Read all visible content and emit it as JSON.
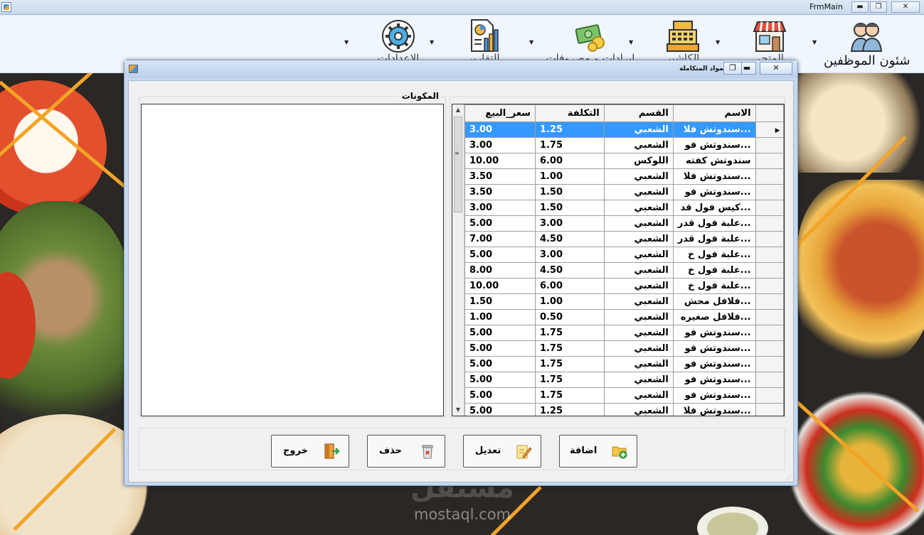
{
  "window": {
    "title": "FrmMain",
    "controls": {
      "minimize": "▬",
      "maximize": "❐",
      "close": "✕"
    }
  },
  "menu": {
    "items": [
      {
        "label": "شئون الموظفين",
        "icon": "employees-icon"
      },
      {
        "label": "المتجر",
        "icon": "store-icon"
      },
      {
        "label": "الكاشير",
        "icon": "cash-register-icon"
      },
      {
        "label": "ايرادات و مصروفات",
        "icon": "money-icon"
      },
      {
        "label": "التقارير",
        "icon": "report-icon"
      },
      {
        "label": "الاعدادات",
        "icon": "settings-icon"
      }
    ]
  },
  "watermark": {
    "logo": "مستقل",
    "text": "mostaql.com"
  },
  "dialog": {
    "title": "المواد المتكاملة",
    "ingredients_label": "المكونات",
    "grid": {
      "columns": [
        "الاسم",
        "القسم",
        "التكلفة",
        "سعر_البيع"
      ],
      "rows": [
        {
          "name": "سندوتش فلا...",
          "category": "الشعبي",
          "cost": "1.25",
          "price": "3.00"
        },
        {
          "name": "سندوتش فو...",
          "category": "الشعبي",
          "cost": "1.75",
          "price": "3.00"
        },
        {
          "name": "سندوتش كفته",
          "category": "اللوكس",
          "cost": "6.00",
          "price": "10.00"
        },
        {
          "name": "سندوتش فلا...",
          "category": "الشعبي",
          "cost": "1.00",
          "price": "3.50"
        },
        {
          "name": "سندوتش فو...",
          "category": "الشعبي",
          "cost": "1.50",
          "price": "3.50"
        },
        {
          "name": "كيس فول قد...",
          "category": "الشعبي",
          "cost": "1.50",
          "price": "3.00"
        },
        {
          "name": "علبة فول قدر...",
          "category": "الشعبي",
          "cost": "3.00",
          "price": "5.00"
        },
        {
          "name": "علبة فول قدر...",
          "category": "الشعبي",
          "cost": "4.50",
          "price": "7.00"
        },
        {
          "name": "علبة فول خ...",
          "category": "الشعبي",
          "cost": "3.00",
          "price": "5.00"
        },
        {
          "name": "علبة فول خ...",
          "category": "الشعبي",
          "cost": "4.50",
          "price": "8.00"
        },
        {
          "name": "علبة فول خ...",
          "category": "الشعبي",
          "cost": "6.00",
          "price": "10.00"
        },
        {
          "name": "فلافل محش...",
          "category": "الشعبي",
          "cost": "1.00",
          "price": "1.50"
        },
        {
          "name": "فلافل صغيره...",
          "category": "الشعبي",
          "cost": "0.50",
          "price": "1.00"
        },
        {
          "name": "سندوتش فو...",
          "category": "الشعبي",
          "cost": "1.75",
          "price": "5.00"
        },
        {
          "name": "سندوتش فو...",
          "category": "الشعبي",
          "cost": "1.75",
          "price": "5.00"
        },
        {
          "name": "سندوتش فو...",
          "category": "الشعبي",
          "cost": "1.75",
          "price": "5.00"
        },
        {
          "name": "سندوتش فو...",
          "category": "الشعبي",
          "cost": "1.75",
          "price": "5.00"
        },
        {
          "name": "سندوتش فو...",
          "category": "الشعبي",
          "cost": "1.75",
          "price": "5.00"
        },
        {
          "name": "سندوتش فلا...",
          "category": "الشعبي",
          "cost": "1.25",
          "price": "5.00"
        }
      ],
      "selected_row": 0
    },
    "buttons": {
      "add": "اضافة",
      "edit": "تعديل",
      "delete": "حذف",
      "exit": "خروج"
    }
  },
  "colors": {
    "selection": "#3399ff",
    "accent_stripe": "#f3a425"
  }
}
